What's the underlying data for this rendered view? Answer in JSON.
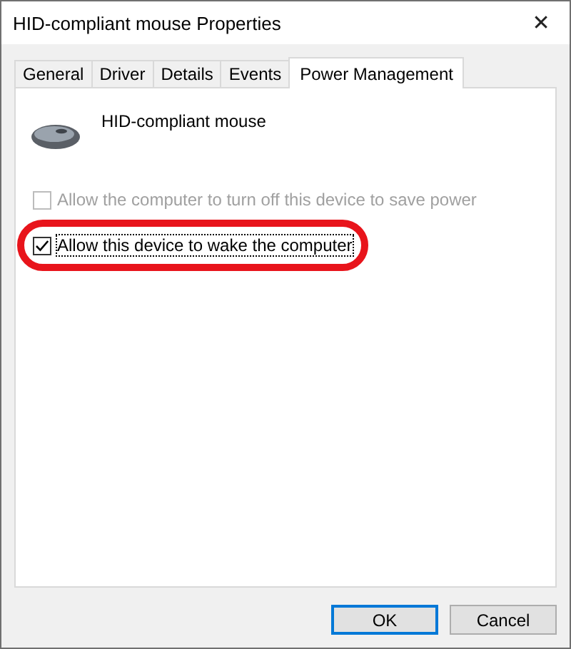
{
  "window": {
    "title": "HID-compliant mouse Properties",
    "close": "✕"
  },
  "tabs": [
    {
      "label": "General",
      "selected": false
    },
    {
      "label": "Driver",
      "selected": false
    },
    {
      "label": "Details",
      "selected": false
    },
    {
      "label": "Events",
      "selected": false
    },
    {
      "label": "Power Management",
      "selected": true
    }
  ],
  "device": {
    "name": "HID-compliant mouse"
  },
  "options": [
    {
      "label": "Allow the computer to turn off this device to save power",
      "checked": false,
      "disabled": true,
      "highlighted": false
    },
    {
      "label": "Allow this device to wake the computer",
      "checked": true,
      "disabled": false,
      "highlighted": true
    }
  ],
  "buttons": [
    {
      "label": "OK",
      "default": true
    },
    {
      "label": "Cancel",
      "default": false
    }
  ]
}
